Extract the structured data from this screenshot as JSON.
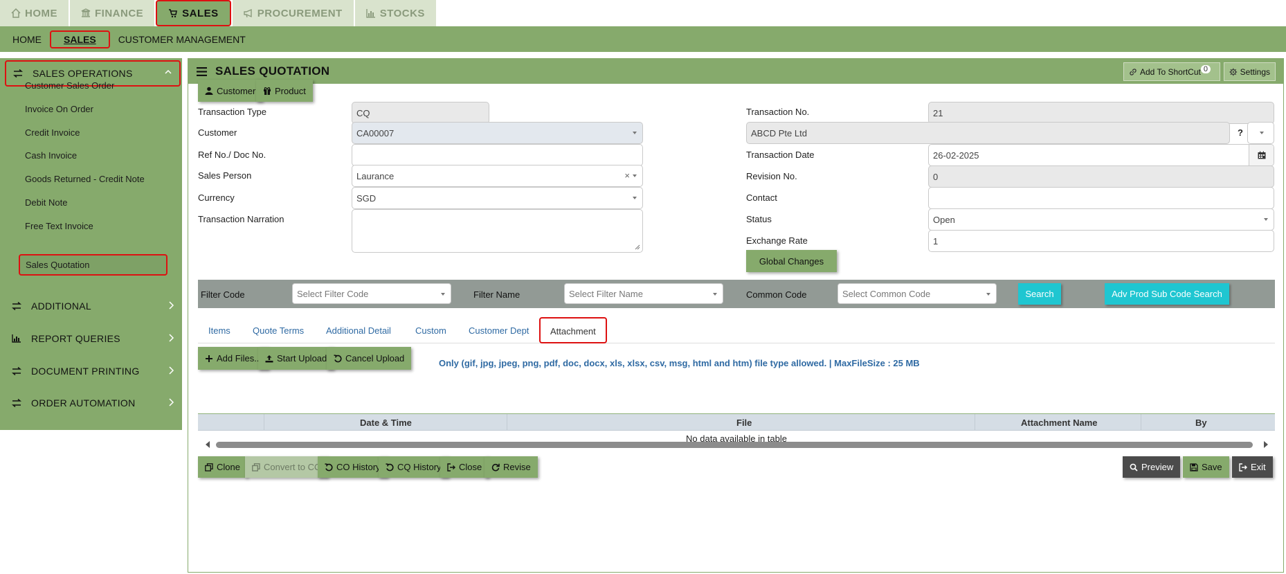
{
  "top_tabs": [
    {
      "label": "HOME",
      "icon": "home-icon"
    },
    {
      "label": "FINANCE",
      "icon": "bank-icon"
    },
    {
      "label": "SALES",
      "icon": "cart-icon"
    },
    {
      "label": "PROCUREMENT",
      "icon": "megaphone-icon"
    },
    {
      "label": "STOCKS",
      "icon": "bar-chart-icon"
    }
  ],
  "sub_nav": [
    "HOME",
    "SALES",
    "CUSTOMER MANAGEMENT"
  ],
  "sidebar": {
    "header": "SALES OPERATIONS",
    "items": [
      "Customer Sales Order",
      "Invoice On Order",
      "Credit Invoice",
      "Cash Invoice",
      "Goods Returned - Credit Note",
      "Debit Note",
      "Free Text Invoice",
      "Sales Quotation"
    ],
    "groups": [
      "ADDITIONAL",
      "REPORT QUERIES",
      "DOCUMENT PRINTING",
      "ORDER AUTOMATION"
    ]
  },
  "panel": {
    "title": "SALES QUOTATION",
    "shortcut_label": "Add To ShortCut",
    "shortcut_count": "0",
    "settings_label": "Settings"
  },
  "top_buttons": {
    "customer": "Customer",
    "product": "Product"
  },
  "form": {
    "transaction_type": {
      "label": "Transaction Type",
      "value": "CQ"
    },
    "customer": {
      "label": "Customer",
      "value": "CA00007",
      "name": "ABCD Pte Ltd",
      "help": "?"
    },
    "ref_no": {
      "label": "Ref No./ Doc No.",
      "value": ""
    },
    "sales_person": {
      "label": "Sales Person",
      "value": "Laurance"
    },
    "currency": {
      "label": "Currency",
      "value": "SGD"
    },
    "narration": {
      "label": "Transaction Narration",
      "value": ""
    },
    "transaction_no": {
      "label": "Transaction No.",
      "value": "21"
    },
    "transaction_date": {
      "label": "Transaction Date",
      "value": "26-02-2025"
    },
    "revision_no": {
      "label": "Revision No.",
      "value": "0"
    },
    "contact": {
      "label": "Contact",
      "value": ""
    },
    "status": {
      "label": "Status",
      "value": "Open"
    },
    "exchange_rate": {
      "label": "Exchange Rate",
      "value": "1"
    },
    "global_changes": "Global Changes"
  },
  "filter": {
    "code_label": "Filter Code",
    "code_placeholder": "Select Filter Code",
    "name_label": "Filter Name",
    "name_placeholder": "Select Filter Name",
    "common_label": "Common Code",
    "common_placeholder": "Select Common Code",
    "search": "Search",
    "adv_search": "Adv Prod Sub Code Search"
  },
  "tabs": [
    "Items",
    "Quote Terms",
    "Additional Detail",
    "Custom",
    "Customer Dept",
    "Attachment"
  ],
  "upload": {
    "add_files": "Add Files...",
    "start_upload": "Start Upload",
    "cancel_upload": "Cancel Upload",
    "note": "Only (gif, jpg, jpeg, png, pdf, doc, docx, xls, xlsx, csv, msg, html and htm) file type allowed. | MaxFileSize : 25 MB"
  },
  "table": {
    "columns": [
      "Date & Time",
      "File",
      "Attachment Name",
      "By"
    ],
    "empty": "No data available in table"
  },
  "footer": {
    "clone": "Clone",
    "convert": "Convert to CO",
    "co_history": "CO History",
    "cq_history": "CQ History",
    "close": "Close",
    "revise": "Revise",
    "preview": "Preview",
    "save": "Save",
    "exit": "Exit"
  },
  "colors": {
    "accent": "#86aa6c",
    "highlight": "#dd1111",
    "cyan": "#1fc6d1",
    "link": "#2f6aa3"
  }
}
